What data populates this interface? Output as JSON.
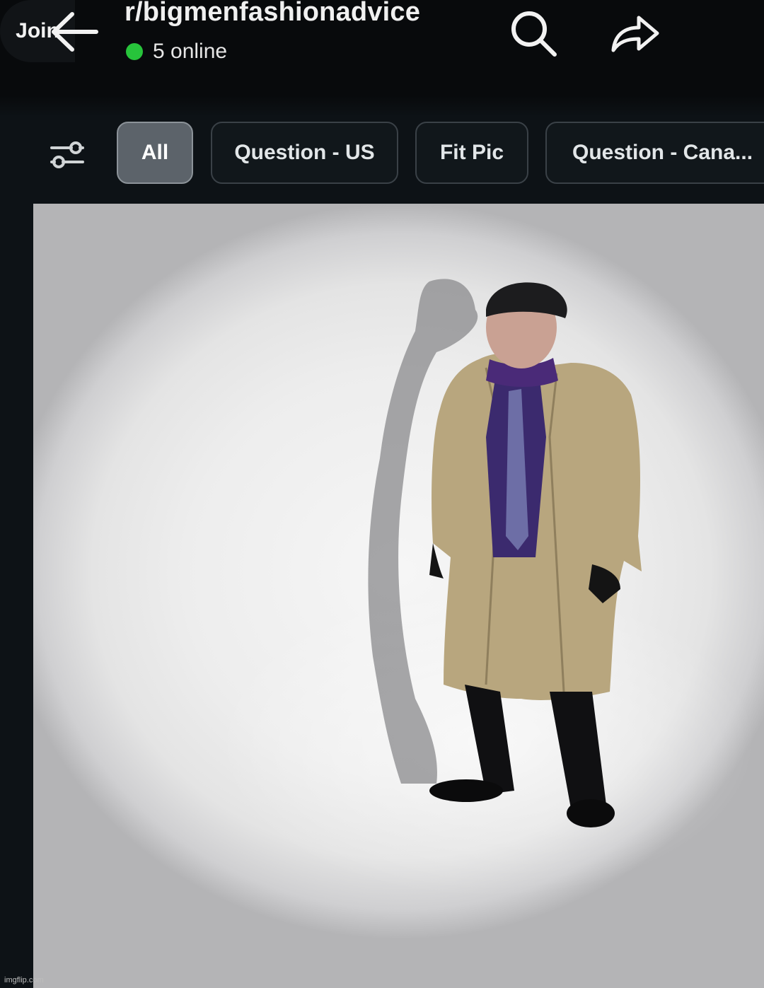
{
  "header": {
    "subreddit": "r/bigmenfashionadvice",
    "online_status": "5 online",
    "join_label": "Join"
  },
  "filters": {
    "chips": [
      {
        "label": "All",
        "selected": true
      },
      {
        "label": "Question - US",
        "selected": false
      },
      {
        "label": "Fit Pic",
        "selected": false
      },
      {
        "label": "Question - Cana...",
        "selected": false
      }
    ]
  },
  "icons": {
    "back": "arrow-left-icon",
    "search": "search-icon",
    "share": "share-icon",
    "filter": "sliders-icon"
  },
  "colors": {
    "online_dot": "#27c43b",
    "active_chip": "#5c636a"
  },
  "watermark": "imgflip.com"
}
